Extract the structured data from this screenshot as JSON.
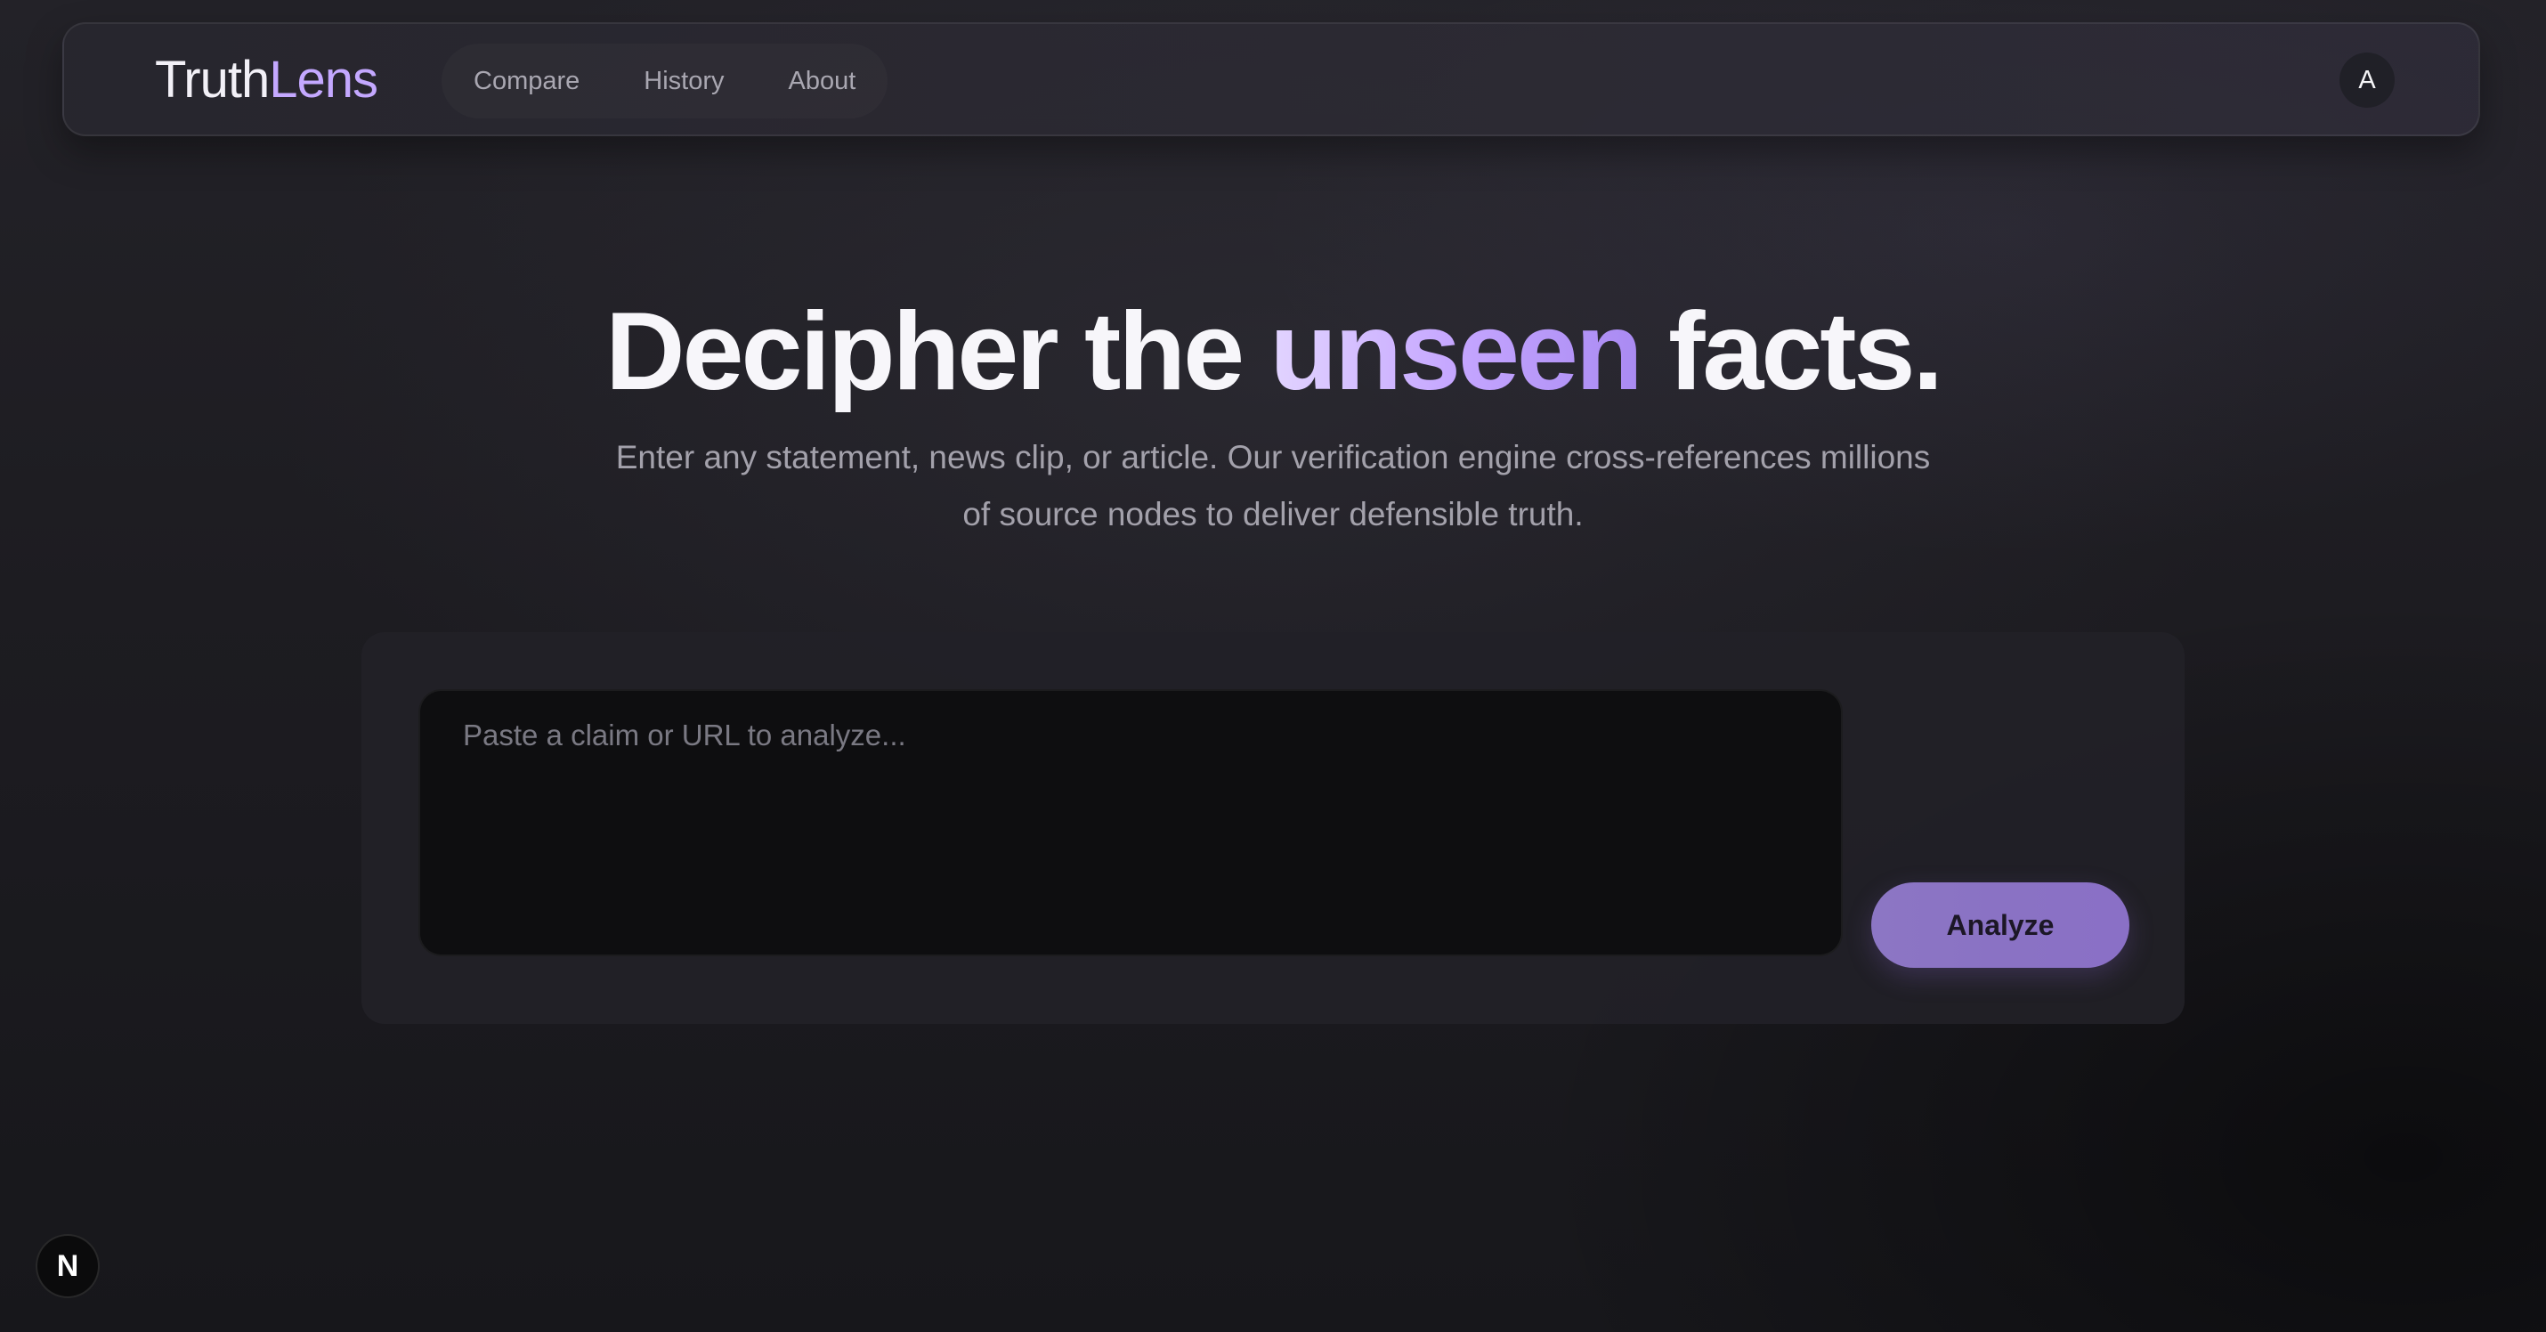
{
  "navbar": {
    "brand": {
      "part1": "Truth",
      "part2": "Lens"
    },
    "links": [
      {
        "label": "Compare"
      },
      {
        "label": "History"
      },
      {
        "label": "About"
      }
    ],
    "avatar_initial": "A"
  },
  "hero": {
    "title_before": "Decipher the ",
    "title_highlight": "unseen",
    "title_after": " facts.",
    "subtitle": "Enter any statement, news clip, or article. Our verification engine cross-references millions of source nodes to deliver defensible truth."
  },
  "claim_form": {
    "placeholder": "Paste a claim or URL to analyze...",
    "value": "",
    "submit_label": "Analyze"
  },
  "dev_badge": {
    "label": "N"
  },
  "colors": {
    "accent": "#c4a8ff",
    "button": "#8a72c4",
    "background": "#1d1c21"
  }
}
